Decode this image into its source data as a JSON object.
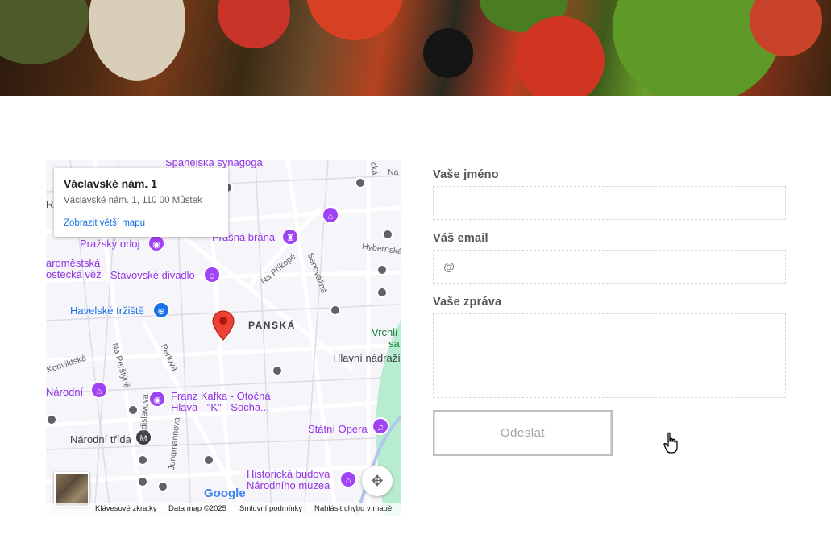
{
  "map": {
    "info": {
      "title": "Václavské nám. 1",
      "address": "Václavské nám. 1, 110 00 Můstek",
      "link": "Zobrazit větší mapu"
    },
    "pois": {
      "synagogue": "Španělská synagoga",
      "orloj": "Pražský orloj",
      "prasna": "Prašná brána",
      "clock_line1": "aroměstská",
      "clock_line2": "ostecká věž",
      "stavovske": "Stavovské divadlo",
      "havelske": "Havelské tržiště",
      "narodni": "Národní",
      "kafka_line1": "Franz Kafka - Otočná",
      "kafka_line2": "Hlava - \"K\" - Socha...",
      "statni": "Státní Opera",
      "museum_line1": "Historická budova",
      "museum_line2": "Národního muzea",
      "vrchl1": "Vrchli",
      "vrchl2": "sa"
    },
    "places": {
      "panska": "PANSKÁ",
      "hlavni": "Hlavní nádraží",
      "narodni_trida": "Národní třída",
      "ra": "RA"
    },
    "streets": {
      "na_prikope": "Na Příkopě",
      "senovazna": "Senovážná",
      "hybernska": "Hybernská",
      "perlova": "Perlova",
      "na_perstyne": "Na Perštýně",
      "konviktska": "Konviktská",
      "vladislavova": "Vladislavova",
      "jungmannova": "Jungmannova",
      "na": "Na",
      "cka": "cká"
    },
    "footer": {
      "shortcuts": "Klávesové zkratky",
      "data": "Data map ©2025",
      "terms": "Smluvní podmínky",
      "report": "Nahlásit chybu v mapě"
    },
    "logo": "Google"
  },
  "form": {
    "name_label": "Vaše jméno",
    "name_value": "",
    "email_label": "Váš email",
    "email_placeholder": "@",
    "message_label": "Vaše zpráva",
    "message_value": "",
    "submit": "Odeslat"
  }
}
